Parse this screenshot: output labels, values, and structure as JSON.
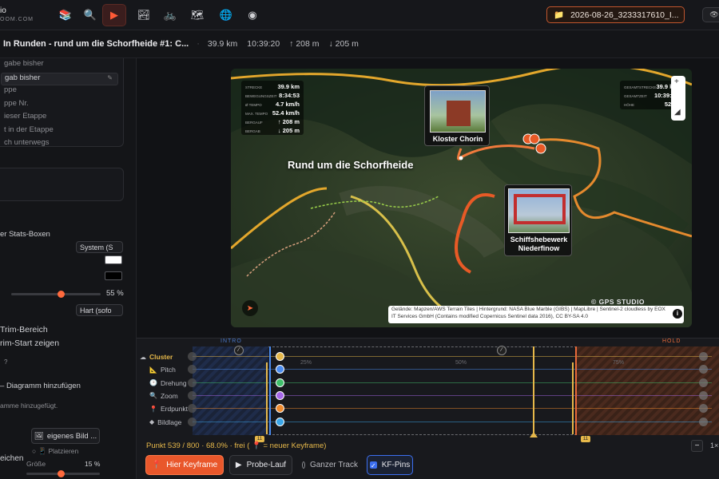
{
  "topbar": {
    "brand_title": "io",
    "brand_sub": "OOM.COM",
    "tools": [
      {
        "icon": "layers-icon",
        "glyph": "📚",
        "active": false
      },
      {
        "icon": "search-icon",
        "glyph": "🔍",
        "active": false
      },
      {
        "icon": "play-icon",
        "glyph": "▶",
        "active": true
      },
      {
        "icon": "photo-icon",
        "glyph": "🏞",
        "active": false
      },
      {
        "icon": "bike-icon",
        "glyph": "🚲",
        "active": false
      },
      {
        "icon": "map-icon",
        "glyph": "🗺",
        "active": false
      },
      {
        "icon": "globe-icon",
        "glyph": "🌐",
        "active": false
      },
      {
        "icon": "record-icon",
        "glyph": "◉",
        "active": false
      }
    ],
    "project": "2026-08-26_3233317610_I...",
    "eye_glyph": "👁"
  },
  "titlebar": {
    "title": "In Runden - rund um die Schorfheide #1: C...",
    "distance": "39.9 km",
    "duration": "10:39:20",
    "ascent": "↑ 208 m",
    "descent": "↓ 205 m"
  },
  "left": {
    "list_items": [
      "gabe bisher",
      "gab bisher",
      "ppe",
      "ppe Nr.",
      "ieser Etappe",
      "t in der Etappe",
      "ch unterwegs"
    ],
    "stats_title": "er Stats-Boxen",
    "font_select": "System (S",
    "text_color": "#ffffff",
    "bg_color": "#000000",
    "opacity_value": "55 %",
    "opacity": 0.55,
    "shadow_select": "Hart (sofo",
    "trim_title": "Trim-Bereich",
    "trim_start": "rim-Start zeigen",
    "help": "?",
    "add_chart": "Diagramm hinzufügen",
    "no_chart": "amme hinzugefügt.",
    "own_image": "eigenes Bild ...",
    "place": "Platzieren",
    "signs_title": "eichen",
    "size_label": "Größe",
    "size_value": "15 %",
    "size": 0.15
  },
  "map": {
    "title": "Rund um die Schorfheide",
    "stats_left": [
      {
        "k": "STRECKE",
        "v": "39.9 km"
      },
      {
        "k": "BEWEGUNGSZEIT",
        "v": "8:34:53"
      },
      {
        "k": "Ø TEMPO",
        "v": "4.7 km/h"
      },
      {
        "k": "MAX. TEMPO",
        "v": "52.4 km/h"
      },
      {
        "k": "BERGAUF",
        "v": "↑ 208 m"
      },
      {
        "k": "BERGAB",
        "v": "↓ 205 m"
      }
    ],
    "stats_right": [
      {
        "k": "GESAMTSTRECKE",
        "v": "39.9 km"
      },
      {
        "k": "GESAMTZEIT",
        "v": "10:39:20"
      },
      {
        "k": "HÖHE",
        "v": "52 m"
      }
    ],
    "poi1": "Kloster Chorin",
    "poi2": "Schiffshebewerk Niederfinow",
    "watermark": "© GPS STUDIO",
    "attribution": "Gelände: Mapzen/AWS Terrain Tiles | Hintergrund: NASA Blue Marble (GIBS) | MapLibre | Sentinel-2 cloudless by EOX IT Services GmbH (Contains modified Copernicus Sentinel data 2016), CC BY-SA 4.0",
    "info_glyph": "i",
    "compass_glyph": "➤"
  },
  "timeline": {
    "intro": "INTRO",
    "hold": "HOLD",
    "ticks": [
      "25%",
      "50%",
      "75%"
    ],
    "tracks": [
      {
        "icon": "cluster-icon",
        "glyph": "☁",
        "label": "Cluster",
        "color": "#e6b84a"
      },
      {
        "icon": "pitch-icon",
        "glyph": "📐",
        "label": "Pitch",
        "color": "#4a8cf0"
      },
      {
        "icon": "rotation-icon",
        "glyph": "🕑",
        "label": "Drehung",
        "color": "#3fbf6b"
      },
      {
        "icon": "zoom-icon",
        "glyph": "🔍",
        "label": "Zoom",
        "color": "#a667e8"
      },
      {
        "icon": "pin-icon",
        "glyph": "📍",
        "label": "Erdpunkt",
        "color": "#ee8a2e"
      },
      {
        "icon": "image-icon",
        "glyph": "◆",
        "label": "Bildlage",
        "color": "#3aa6e8"
      }
    ],
    "status": "Punkt 539 / 800 · 68.0% · frei ( 📍 = neuer Keyframe)",
    "progress": 0.68,
    "marker_left": "11",
    "marker_right": "11",
    "add_keyframe": "Hier Keyframe",
    "preview": "Probe-Lauf",
    "full_track": "Ganzer Track",
    "kf_pins": "KF-Pins",
    "zoom_minus": "−",
    "speed": "1×"
  }
}
